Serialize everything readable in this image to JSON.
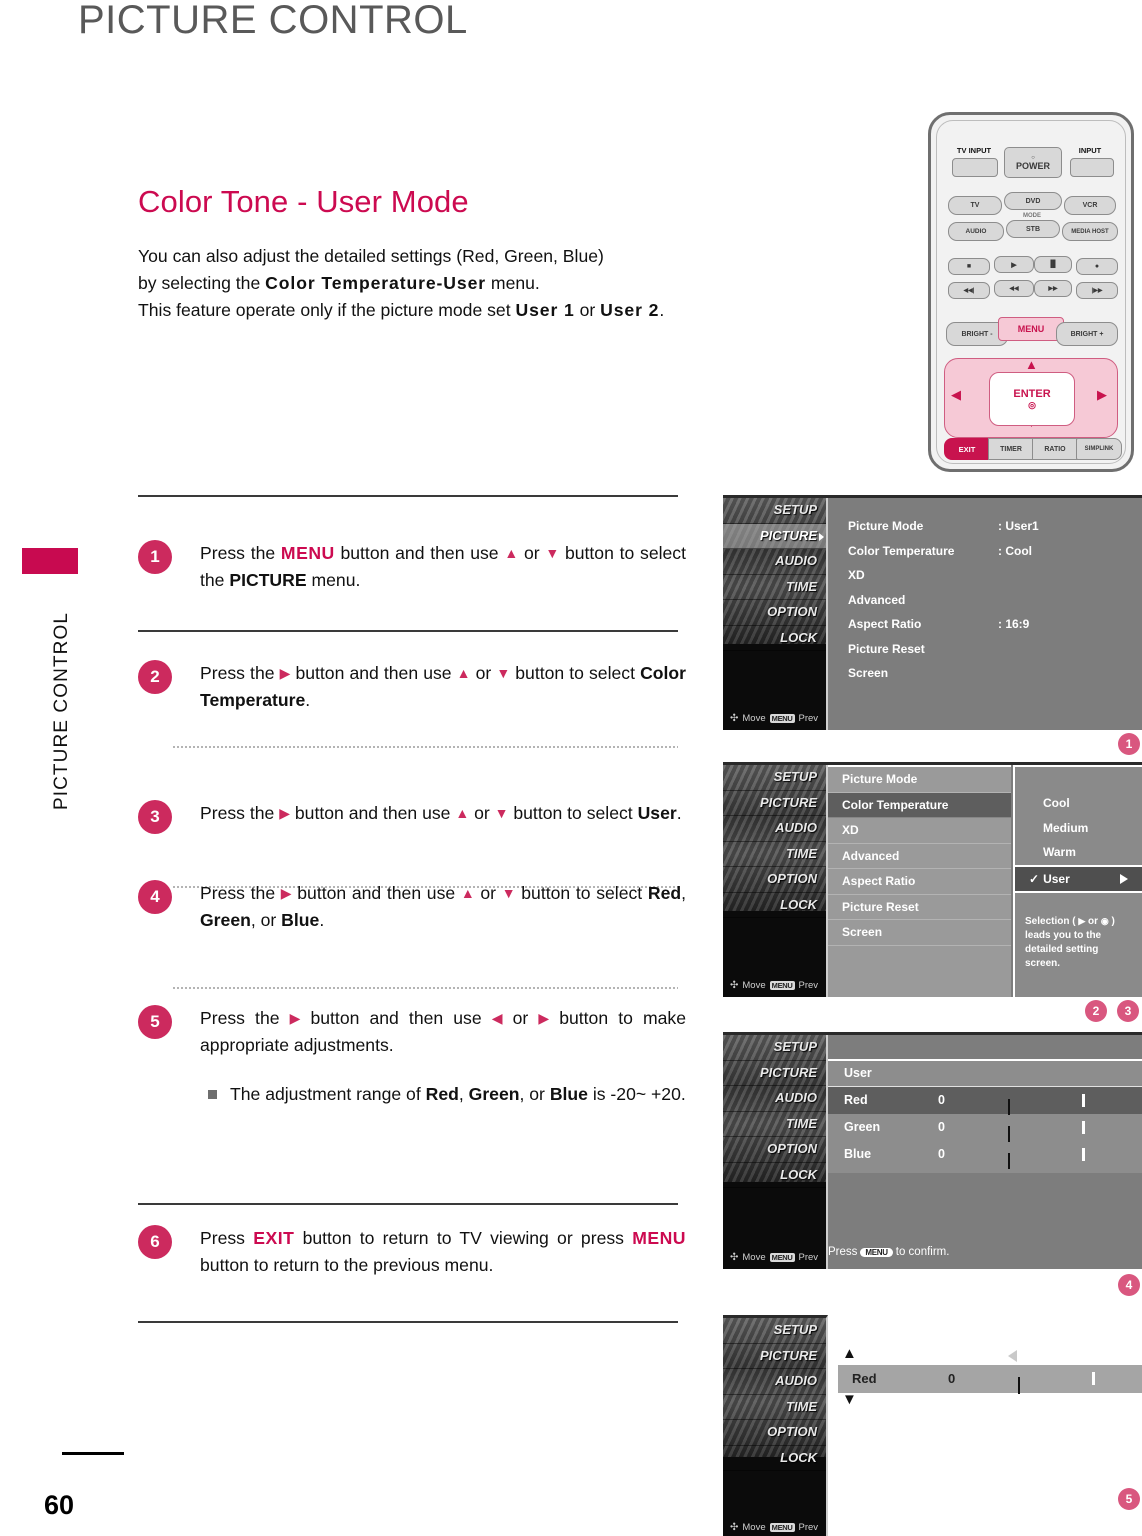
{
  "header": {
    "title": "PICTURE CONTROL"
  },
  "sidebar": {
    "label": "PICTURE CONTROL",
    "page_number": "60"
  },
  "article": {
    "title": "Color Tone - User Mode",
    "intro_line1_a": "You can also adjust the detailed settings (Red, Green, Blue)",
    "intro_line2_a": "by selecting the ",
    "intro_line2_b": "Color Temperature-User",
    "intro_line2_c": " menu.",
    "intro_line3_a": "This feature operate only if the picture mode set ",
    "intro_line3_b": "User 1",
    "intro_line3_c": " or ",
    "intro_line3_d": "User 2",
    "intro_line3_e": "."
  },
  "steps": [
    {
      "num": "1",
      "p1": "Press the ",
      "kw1": "MENU",
      "p2": " button and then use ",
      "p3": " or ",
      "p4": " button to select the ",
      "kw2": "PICTURE",
      "p5": " menu."
    },
    {
      "num": "2",
      "p1": "Press the ",
      "p2": " button and then use ",
      "p3": " or ",
      "p4": " button to select ",
      "kw": "Color Temperature",
      "p5": "."
    },
    {
      "num": "3",
      "p1": "Press the ",
      "p2": " button and then use ",
      "p3": " or ",
      "p4": " button to select ",
      "kw": "User",
      "p5": "."
    },
    {
      "num": "4",
      "p1": "Press the ",
      "p2": " button and then use ",
      "p3": " or ",
      "p4": " button to select ",
      "kw1": "Red",
      "p5": ", ",
      "kw2": "Green",
      "p6": ", or ",
      "kw3": "Blue",
      "p7": "."
    },
    {
      "num": "5",
      "p1": "Press the ",
      "p2": " button and then use ",
      "p3": " or ",
      "p4": " button to make appropriate adjustments.",
      "note_a": "The adjustment range of ",
      "note_kw1": "Red",
      "note_b": ", ",
      "note_kw2": "Green",
      "note_c": ", or ",
      "note_kw3": "Blue",
      "note_d": " is -20~ +20."
    },
    {
      "num": "6",
      "p1": "Press ",
      "kw1": "EXIT",
      "p2": " button to return to TV viewing or press ",
      "kw2": "MENU",
      "p3": " button to return to the previous menu."
    }
  ],
  "osd_common": {
    "menu_items": [
      "SETUP",
      "PICTURE",
      "AUDIO",
      "TIME",
      "OPTION",
      "LOCK"
    ],
    "footer_move": "Move",
    "footer_menu_key": "MENU",
    "footer_prev": "Prev"
  },
  "osd1": {
    "rows": [
      {
        "label": "Picture Mode",
        "value": ": User1"
      },
      {
        "label": "Color Temperature",
        "value": ": Cool"
      },
      {
        "label": "XD",
        "value": ""
      },
      {
        "label": "Advanced",
        "value": ""
      },
      {
        "label": "Aspect Ratio",
        "value": ": 16:9"
      },
      {
        "label": "Picture Reset",
        "value": ""
      },
      {
        "label": "Screen",
        "value": ""
      }
    ],
    "marker": "1"
  },
  "osd2": {
    "rows": [
      "Picture Mode",
      "Color Temperature",
      "XD",
      "Advanced",
      "Aspect Ratio",
      "Picture Reset",
      "Screen"
    ],
    "selected_row": "Color Temperature",
    "options": [
      "Cool",
      "Medium",
      "Warm",
      "User"
    ],
    "selected_option": "User",
    "check_glyph": "✓",
    "hint_a": "Selection ( ",
    "hint_b": " or ",
    "hint_c": " ) leads you  to the detailed setting screen.",
    "markers": [
      "2",
      "3"
    ]
  },
  "osd3": {
    "heading": "User",
    "sliders": [
      {
        "label": "Red",
        "value": "0",
        "percent": 50
      },
      {
        "label": "Green",
        "value": "0",
        "percent": 50
      },
      {
        "label": "Blue",
        "value": "0",
        "percent": 50
      }
    ],
    "selected": "Red",
    "confirm_a": "Press",
    "confirm_key": "MENU",
    "confirm_b": "to confirm.",
    "marker": "4"
  },
  "osd4": {
    "label": "Red",
    "value": "0",
    "percent": 50,
    "up_glyph": "▲",
    "down_glyph": "▼",
    "marker": "5"
  },
  "remote": {
    "tv_input": "TV INPUT",
    "power": "POWER",
    "input": "INPUT",
    "tv": "TV",
    "dvd": "DVD",
    "vcr": "VCR",
    "mode": "MODE",
    "audio": "AUDIO",
    "stb": "STB",
    "media_host": "MEDIA HOST",
    "stop": "■",
    "play": "▶",
    "pause": "▐▌",
    "record": "●",
    "skip_back": "◀◀|",
    "rew": "◀◀",
    "ff": "▶▶",
    "skip_fwd": "|▶▶",
    "bright_minus": "BRIGHT -",
    "menu": "MENU",
    "bright_plus": "BRIGHT +",
    "enter": "ENTER",
    "up": "▲",
    "down": "▼",
    "left": "◀",
    "right": "▶",
    "exit": "EXIT",
    "timer": "TIMER",
    "ratio": "RATIO",
    "simplink": "SIMPLINK"
  },
  "colors": {
    "accent": "#cc0a50",
    "badge": "#cc2a5e",
    "marker": "#d9577f",
    "header_gray": "#595959"
  }
}
